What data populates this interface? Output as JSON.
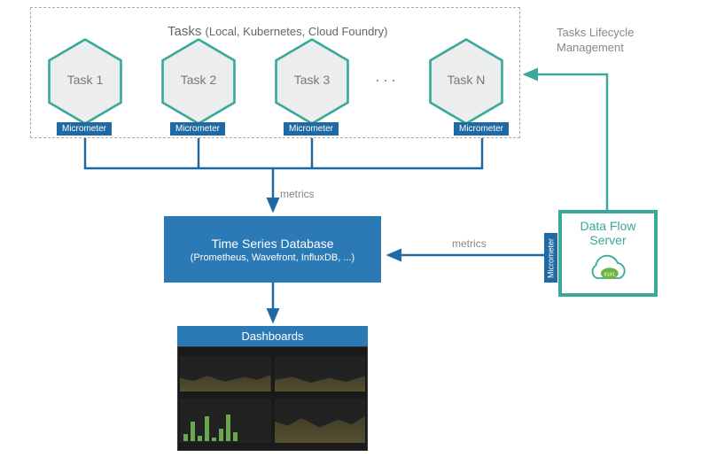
{
  "tasksGroup": {
    "title": "Tasks",
    "subtitle": "(Local, Kubernetes, Cloud Foundry)"
  },
  "tasks": [
    {
      "label": "Task 1",
      "badge": "Micrometer"
    },
    {
      "label": "Task 2",
      "badge": "Micrometer"
    },
    {
      "label": "Task 3",
      "badge": "Micrometer"
    },
    {
      "label": "Task N",
      "badge": "Micrometer"
    }
  ],
  "ellipsis": "···",
  "tsdb": {
    "title": "Time Series Database",
    "subtitle": "(Prometheus, Wavefront, InfluxDB, ...)"
  },
  "dashboards": {
    "title": "Dashboards"
  },
  "dfs": {
    "line1": "Data Flow",
    "line2": "Server",
    "badge": "Micrometer"
  },
  "lifecycle": {
    "line1": "Tasks Lifecycle",
    "line2": "Management"
  },
  "arrowLabels": {
    "metrics1": "metrics",
    "metrics2": "metrics"
  }
}
